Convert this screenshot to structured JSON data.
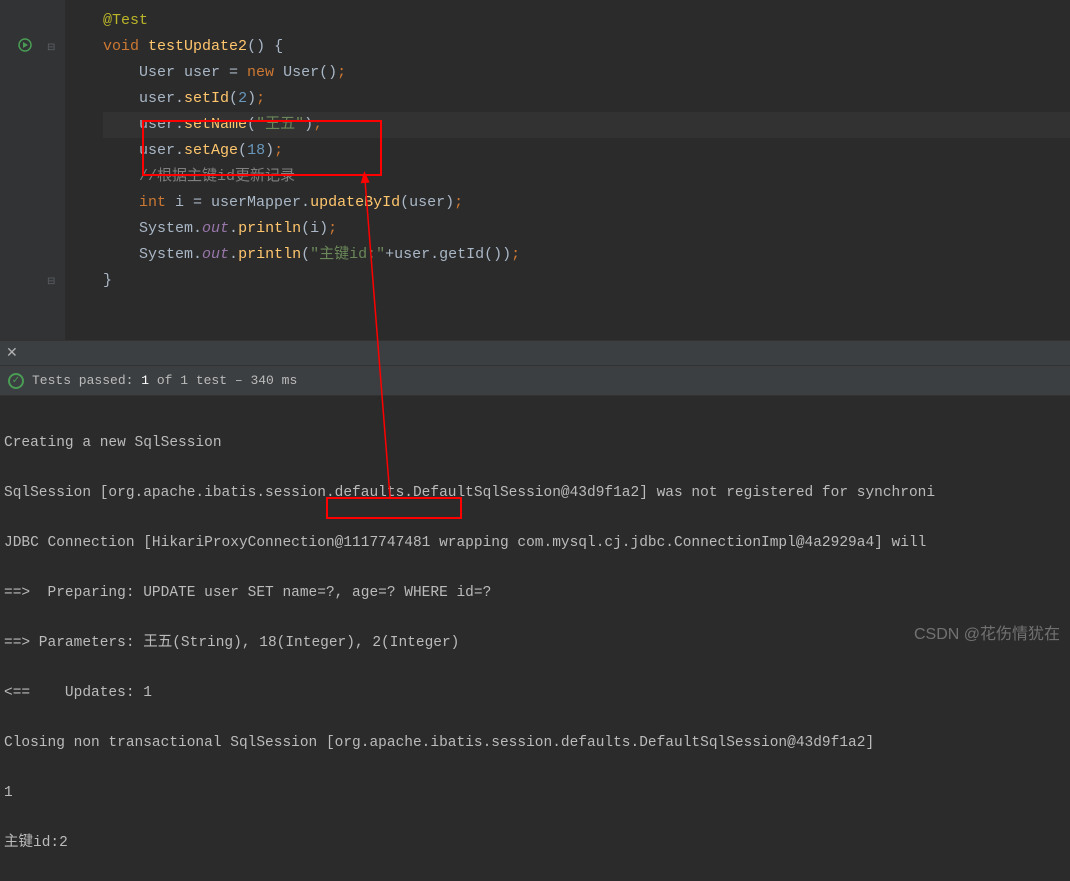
{
  "code": {
    "l1": "@Test",
    "l2_void": "void",
    "l2_name": "testUpdate2",
    "l2_rest": "() {",
    "l3_a": "User user = ",
    "l3_new": "new",
    "l3_b": " User()",
    "l4_a": "user.",
    "l4_m": "setId",
    "l4_p": "(",
    "l4_n": "2",
    "l4_r": ")",
    "l5_a": "user.",
    "l5_m": "setName",
    "l5_p": "(",
    "l5_s": "\"王五\"",
    "l5_r": ")",
    "l6_a": "user.",
    "l6_m": "setAge",
    "l6_p": "(",
    "l6_n": "18",
    "l6_r": ")",
    "l7": "//根据主键id更新记录",
    "l8_int": "int",
    "l8_a": " i = userMapper.",
    "l8_m": "updateById",
    "l8_r": "(user)",
    "l9_a": "System.",
    "l9_out": "out",
    "l9_b": ".",
    "l9_m": "println",
    "l9_r": "(i)",
    "l10_a": "System.",
    "l10_out": "out",
    "l10_b": ".",
    "l10_m": "println",
    "l10_p": "(",
    "l10_s": "\"主键id:\"",
    "l10_r": "+user.getId())",
    "l11": "}",
    "semi": ";"
  },
  "status": {
    "label_a": "Tests passed:",
    "count": " 1 ",
    "label_b": "of 1 test",
    "time": " – 340 ms"
  },
  "console": {
    "l1": "Creating a new SqlSession",
    "l2": "SqlSession [org.apache.ibatis.session.defaults.DefaultSqlSession@43d9f1a2] was not registered for synchroni",
    "l3": "JDBC Connection [HikariProxyConnection@1117747481 wrapping com.mysql.cj.jdbc.ConnectionImpl@4a2929a4] will ",
    "l4": "==>  Preparing: UPDATE user SET name=?, age=? WHERE id=?",
    "l5": "==> Parameters: 王五(String), 18(Integer), 2(Integer)",
    "l6": "<==    Updates: 1",
    "l7": "Closing non transactional SqlSession [org.apache.ibatis.session.defaults.DefaultSqlSession@43d9f1a2]",
    "l8": "1",
    "l9": "主键id:2"
  },
  "watermark": "CSDN @花伤情犹在"
}
